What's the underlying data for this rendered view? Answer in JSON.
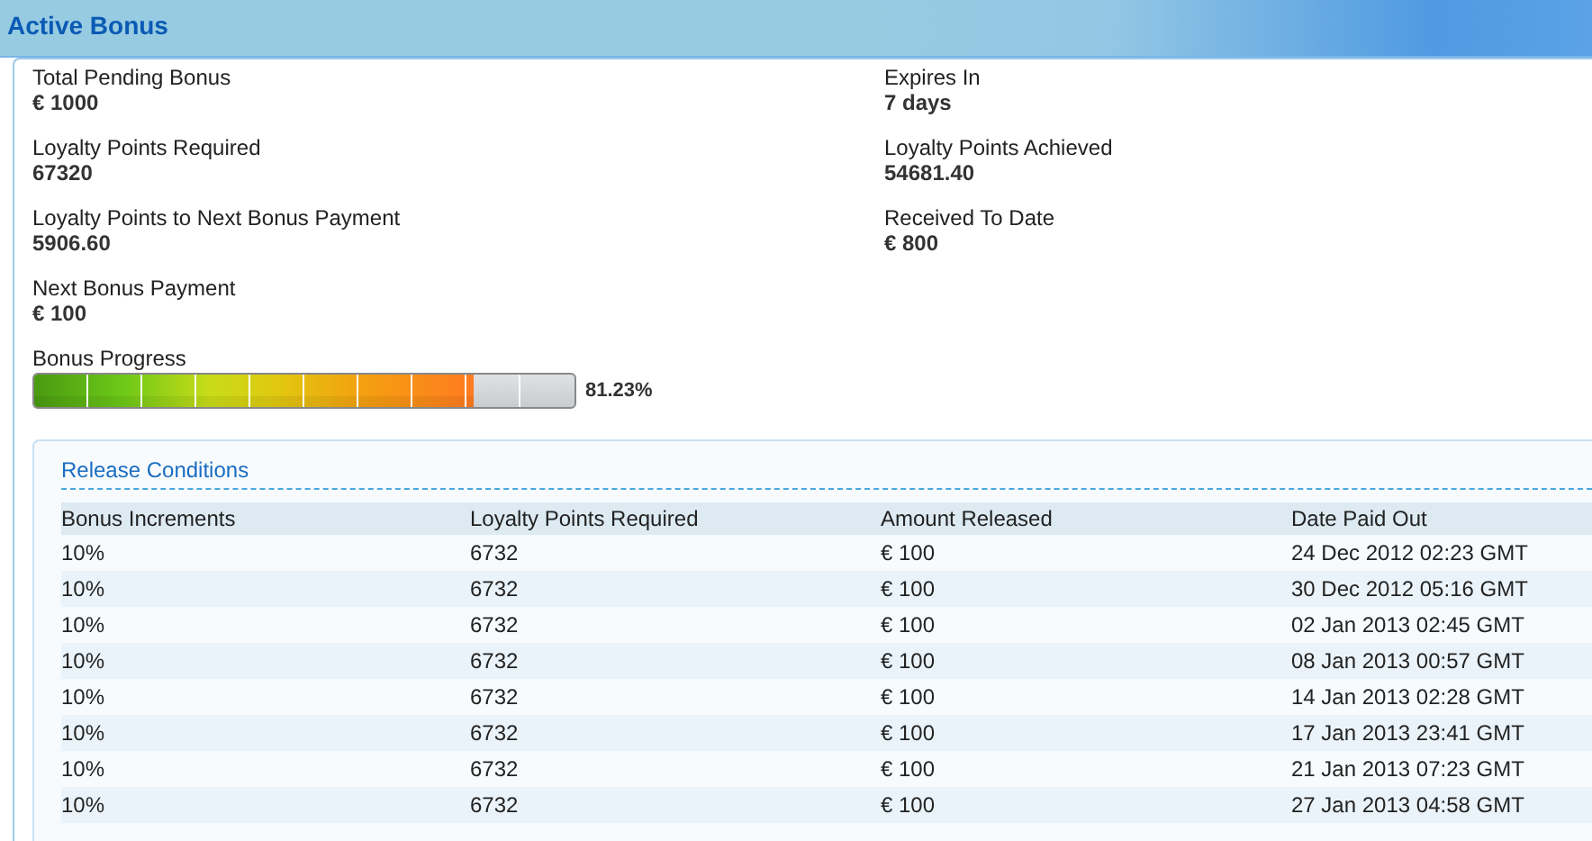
{
  "header": {
    "title": "Active Bonus"
  },
  "fields_left": [
    {
      "label": "Total Pending Bonus",
      "value": "€ 1000"
    },
    {
      "label": "Loyalty Points Required",
      "value": "67320"
    },
    {
      "label": "Loyalty Points to Next Bonus Payment",
      "value": "5906.60"
    },
    {
      "label": "Next Bonus Payment",
      "value": "€ 100"
    }
  ],
  "fields_right": [
    {
      "label": "Expires In",
      "value": "7 days"
    },
    {
      "label": "Loyalty Points Achieved",
      "value": "54681.40"
    },
    {
      "label": "Received To Date",
      "value": "€ 800"
    }
  ],
  "progress": {
    "label": "Bonus Progress",
    "level": 0.8123,
    "reading": "81.23%"
  },
  "release_conditions": {
    "title": "Release Conditions",
    "columns": [
      "Bonus Increments",
      "Loyalty Points Required",
      "Amount Released",
      "Date Paid Out"
    ],
    "rows": [
      [
        "10%",
        "6732",
        "€ 100",
        "24 Dec 2012 02:23 GMT"
      ],
      [
        "10%",
        "6732",
        "€ 100",
        "30 Dec 2012 05:16 GMT"
      ],
      [
        "10%",
        "6732",
        "€ 100",
        "02 Jan 2013 02:45 GMT"
      ],
      [
        "10%",
        "6732",
        "€ 100",
        "08 Jan 2013 00:57 GMT"
      ],
      [
        "10%",
        "6732",
        "€ 100",
        "14 Jan 2013 02:28 GMT"
      ],
      [
        "10%",
        "6732",
        "€ 100",
        "17 Jan 2013 23:41 GMT"
      ],
      [
        "10%",
        "6732",
        "€ 100",
        "21 Jan 2013 07:23 GMT"
      ],
      [
        "10%",
        "6732",
        "€ 100",
        "27 Jan 2013 04:58 GMT"
      ]
    ]
  }
}
